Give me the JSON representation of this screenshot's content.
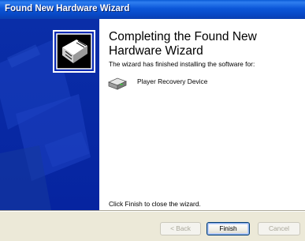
{
  "window": {
    "title": "Found New Hardware Wizard",
    "title_color": "#ffffff",
    "titlebar_color": "#0b56d8"
  },
  "side_panel": {
    "color": "#0a2bb5",
    "icon": "wizard-hardware-icon"
  },
  "main": {
    "heading": "Completing the Found New Hardware Wizard",
    "intro": "The wizard has finished installing the software for:",
    "device": {
      "icon": "hard-drive-icon",
      "label": "Player Recovery Device"
    },
    "finish_hint": "Click Finish to close the wizard."
  },
  "buttons": {
    "back": "< Back",
    "finish": "Finish",
    "cancel": "Cancel"
  }
}
